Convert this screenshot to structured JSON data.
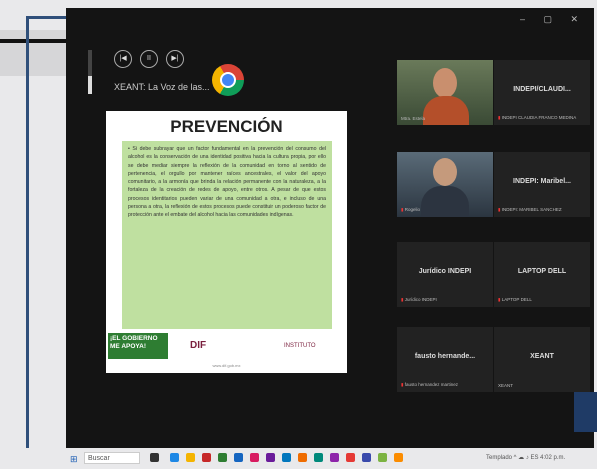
{
  "window": {
    "controls": "–  ▢  ✕"
  },
  "media": {
    "title": "XEANT: La Voz de las...",
    "prev_label": "|◀",
    "play_label": "II",
    "next_label": "▶|",
    "volume_level": 0.4
  },
  "slide": {
    "title": "PREVENCIÓN",
    "body": "• Si debe subrayar que un factor fundamental en la prevención del consumo del alcohol es la conservación de una identidad positiva hacia la cultura propia, por ello se debe mediar siempre la reflexión de la comunidad en torno al sentido de pertenencia, el orgullo por mantener raíces ancestrales, el valor del apoyo comunitario, a la armonía que brinda la relación permanente con la naturaleza, a la fortaleza de la creación de redes de apoyo, entre otros. A pesar de que estos procesos identitarios pueden variar de una comunidad a otra, e incluso de una persona a otra, la reflexión de estos procesos puede constituir un poderoso factor de protección ante el embate del alcohol hacia las comunidades indígenas.",
    "footer_left": "¡EL GOBIERNO ME APOYA!",
    "footer_mid": "DIF",
    "footer_right": "INSTITUTO",
    "caption": "www.dif.gob.mx"
  },
  "participants": [
    {
      "name": "",
      "sub": "Mtra. Estela",
      "video": true
    },
    {
      "name": "INDEPI/CLAUDI...",
      "sub": "INDEPI CLAUDIA FRANCO MEDINA"
    },
    {
      "name": "",
      "sub": "Rogelio",
      "video": true
    },
    {
      "name": "INDEPI: Maribel...",
      "sub": "INDEPI: MARIBEL SANCHEZ"
    },
    {
      "name": "Jurídico INDEPI",
      "sub": "Jurídico INDEPI"
    },
    {
      "name": "LAPTOP DELL",
      "sub": "LAPTOP DELL"
    },
    {
      "name": "fausto hernande...",
      "sub": "fausto hernandez martinez"
    },
    {
      "name": "XEANT",
      "sub": "XEANT"
    }
  ],
  "taskbar": {
    "start_icon": "⊞",
    "search_placeholder": "Buscar",
    "tray": "Templado  ^ ☁ ♪ ES  4:02 p.m."
  }
}
